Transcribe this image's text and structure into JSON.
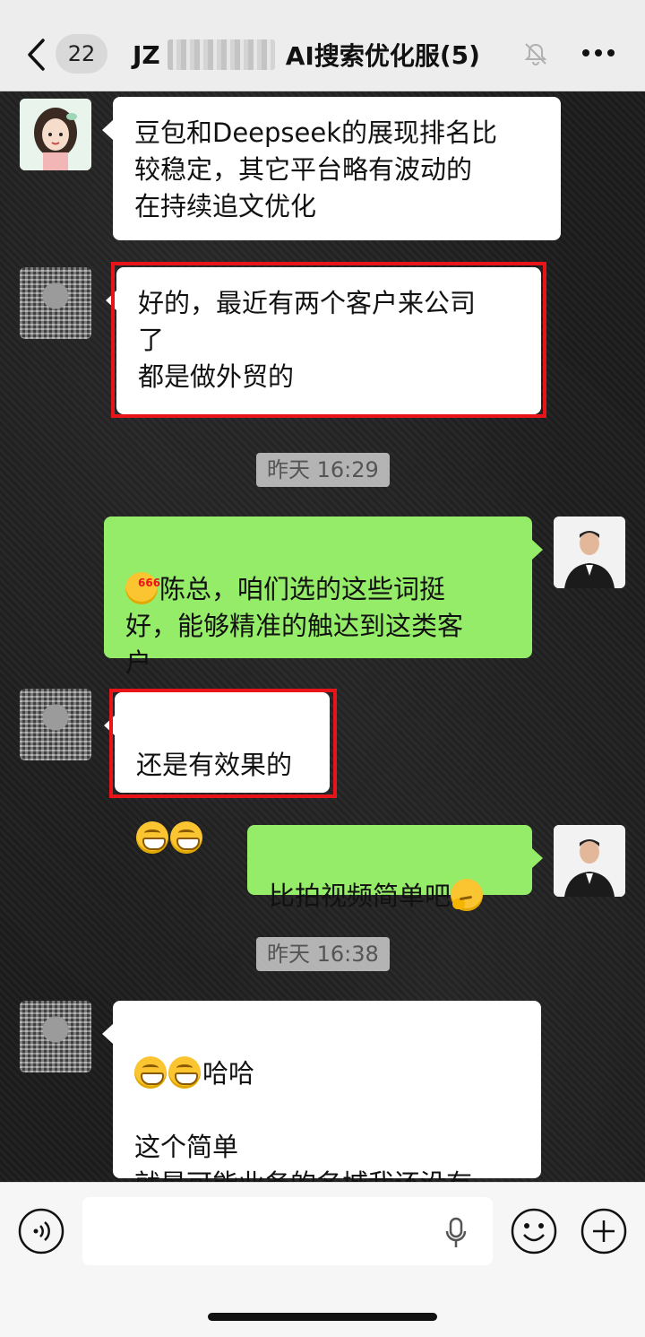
{
  "header": {
    "unread_count": "22",
    "title_prefix": "JZ",
    "title_suffix": "AI搜索优化服",
    "member_count": "(5)"
  },
  "messages": [
    {
      "side": "in",
      "text": "豆包和Deepseek的展现排名比\n较稳定，其它平台略有波动的\n在持续追文优化"
    },
    {
      "side": "in",
      "text": "好的，最近有两个客户来公司\n了\n都是做外贸的"
    },
    {
      "side": "out",
      "text": "陈总，咱们选的这些词挺\n好，能够精准的触达到这类客\n户"
    },
    {
      "side": "in",
      "text": "还是有效果的"
    },
    {
      "side": "out",
      "text": "比拍视频简单吧"
    },
    {
      "side": "in",
      "text_after_emoji": "哈哈",
      "text": "这个简单\n就是可能业务的名城我还没有\n想到哪些扩展"
    }
  ],
  "timestamps": [
    "昨天 16:29",
    "昨天 16:38"
  ],
  "input": {
    "placeholder": ""
  }
}
